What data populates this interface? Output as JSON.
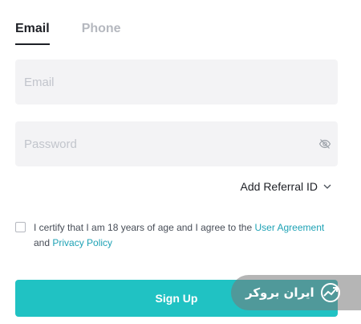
{
  "tabs": [
    {
      "label": "Email",
      "active": true
    },
    {
      "label": "Phone",
      "active": false
    }
  ],
  "form": {
    "email_placeholder": "Email",
    "email_value": "",
    "password_placeholder": "Password",
    "password_value": "",
    "password_toggle_icon": "eye-slash-icon",
    "referral_label": "Add Referral ID",
    "referral_icon": "chevron-down-icon"
  },
  "agreement": {
    "text_before": "I certify that I am 18 years of age and I agree to the ",
    "user_agreement_link": "User Agreement",
    "text_and": " and ",
    "privacy_policy_link": "Privacy Policy",
    "checked": false
  },
  "signup_button": "Sign Up",
  "watermark": {
    "text": "ایران بروکر",
    "icon": "chart-arrow-icon"
  },
  "colors": {
    "accent": "#20c2c3",
    "link": "#1ea2b5",
    "field_bg": "#f3f3f5",
    "text_primary": "#1e2026",
    "text_muted": "#b5b8bf"
  }
}
